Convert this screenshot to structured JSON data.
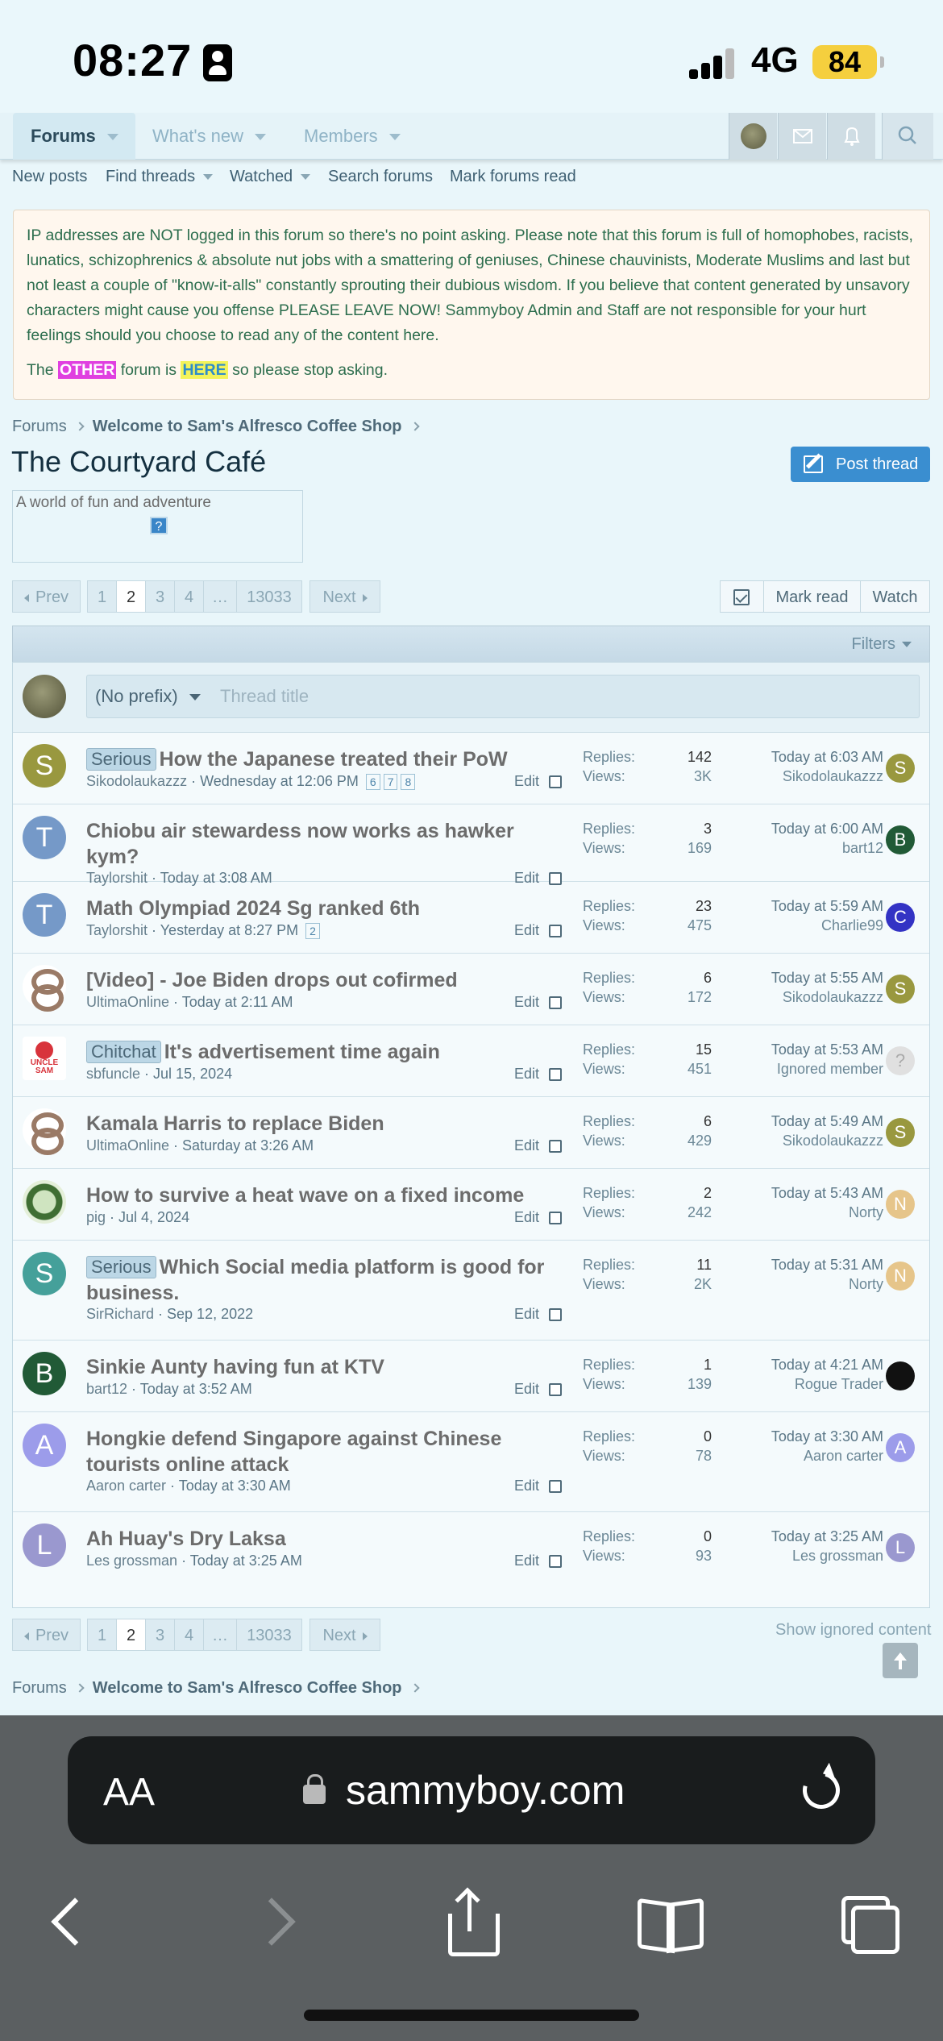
{
  "status": {
    "time": "08:27",
    "network": "4G",
    "battery": "84"
  },
  "nav": {
    "tabs": [
      {
        "label": "Forums"
      },
      {
        "label": "What's new"
      },
      {
        "label": "Members"
      }
    ]
  },
  "subnav": [
    "New posts",
    "Find threads",
    "Watched",
    "Search forums",
    "Mark forums read"
  ],
  "notice": {
    "text": "IP addresses are NOT logged in this forum so there's no point asking. Please note that this forum is full of homophobes, racists, lunatics, schizophrenics & absolute nut jobs with a smattering of geniuses, Chinese chauvinists, Moderate Muslims and last but not least a couple of \"know-it-alls\" constantly sprouting their dubious wisdom. If you believe that content generated by unsavory characters might cause you offense PLEASE LEAVE NOW! Sammyboy Admin and Staff are not responsible for your hurt feelings should you choose to read any of the content here.",
    "line2_a": "The ",
    "other": "OTHER",
    "line2_b": " forum is ",
    "here": "HERE",
    "line2_c": " so please stop asking."
  },
  "breadcrumb": {
    "root": "Forums",
    "parent": "Welcome to Sam's Alfresco Coffee Shop"
  },
  "forum": {
    "title": "The Courtyard Café",
    "post_button": "Post thread",
    "description": "A world of fun and adventure",
    "desc_icon": "?"
  },
  "pagination": {
    "prev": "Prev",
    "pages": [
      "1",
      "2",
      "3",
      "4",
      "…",
      "13033"
    ],
    "current": "2",
    "next": "Next"
  },
  "actions": {
    "mark_read": "Mark read",
    "watch": "Watch"
  },
  "filters": "Filters",
  "quick_thread": {
    "prefix": "(No prefix)",
    "placeholder": "Thread title"
  },
  "labels": {
    "replies": "Replies:",
    "views": "Views:",
    "edit": "Edit"
  },
  "threads": [
    {
      "initial": "S",
      "avatar_color": "#99983f",
      "prefix": "Serious",
      "title": "How the Japanese treated their PoW",
      "author": "Sikodolaukazzz",
      "date": "Wednesday at 12:06 PM",
      "pages": [
        "6",
        "7",
        "8"
      ],
      "replies": "142",
      "views": "3K",
      "last_time": "Today at 6:03 AM",
      "last_user": "Sikodolaukazzz",
      "last_initial": "S",
      "last_color": "#99983f"
    },
    {
      "initial": "T",
      "avatar_color": "#7599c8",
      "prefix": "",
      "title": "Chiobu air stewardess now works as hawker kym?",
      "author": "Taylorshit",
      "date": "Today at 3:08 AM",
      "pages": [],
      "replies": "3",
      "views": "169",
      "last_time": "Today at 6:00 AM",
      "last_user": "bart12",
      "last_initial": "B",
      "last_color": "#215a36"
    },
    {
      "initial": "T",
      "avatar_color": "#7599c8",
      "prefix": "",
      "title": "Math Olympiad 2024 Sg ranked 6th",
      "author": "Taylorshit",
      "date": "Yesterday at 8:27 PM",
      "pages": [
        "2"
      ],
      "replies": "23",
      "views": "475",
      "last_time": "Today at 5:59 AM",
      "last_user": "Charlie99",
      "last_initial": "C",
      "last_color": "#3333c4"
    },
    {
      "initial": "",
      "avatar_color": "knot",
      "prefix": "",
      "title": "[Video] - Joe Biden drops out cofirmed",
      "author": "UltimaOnline",
      "date": "Today at 2:11 AM",
      "pages": [],
      "replies": "6",
      "views": "172",
      "last_time": "Today at 5:55 AM",
      "last_user": "Sikodolaukazzz",
      "last_initial": "S",
      "last_color": "#99983f"
    },
    {
      "initial": "",
      "avatar_color": "uncle",
      "prefix": "Chitchat",
      "title": "It's advertisement time again",
      "author": "sbfuncle",
      "date": "Jul 15, 2024",
      "pages": [],
      "replies": "15",
      "views": "451",
      "last_time": "Today at 5:53 AM",
      "last_user": "Ignored member",
      "last_initial": "?",
      "last_color": "#e0e0e0"
    },
    {
      "initial": "",
      "avatar_color": "knot",
      "prefix": "",
      "title": "Kamala Harris to replace Biden",
      "author": "UltimaOnline",
      "date": "Saturday at 3:26 AM",
      "pages": [],
      "replies": "6",
      "views": "429",
      "last_time": "Today at 5:49 AM",
      "last_user": "Sikodolaukazzz",
      "last_initial": "S",
      "last_color": "#99983f"
    },
    {
      "initial": "",
      "avatar_color": "pig",
      "prefix": "",
      "title": "How to survive a heat wave on a fixed income",
      "author": "pig",
      "date": "Jul 4, 2024",
      "pages": [],
      "replies": "2",
      "views": "242",
      "last_time": "Today at 5:43 AM",
      "last_user": "Norty",
      "last_initial": "N",
      "last_color": "#e6c58a"
    },
    {
      "initial": "S",
      "avatar_color": "#45a09a",
      "prefix": "Serious",
      "title": "Which Social media platform is good for business.",
      "author": "SirRichard",
      "date": "Sep 12, 2022",
      "pages": [],
      "replies": "11",
      "views": "2K",
      "last_time": "Today at 5:31 AM",
      "last_user": "Norty",
      "last_initial": "N",
      "last_color": "#e6c58a"
    },
    {
      "initial": "B",
      "avatar_color": "#215a36",
      "prefix": "",
      "title": "Sinkie Aunty having fun at KTV",
      "author": "bart12",
      "date": "Today at 3:52 AM",
      "pages": [],
      "replies": "1",
      "views": "139",
      "last_time": "Today at 4:21 AM",
      "last_user": "Rogue Trader",
      "last_initial": "",
      "last_color": "#111111"
    },
    {
      "initial": "A",
      "avatar_color": "#9c9cea",
      "prefix": "",
      "title": "Hongkie defend Singapore against Chinese tourists online attack",
      "author": "Aaron carter",
      "date": "Today at 3:30 AM",
      "pages": [],
      "replies": "0",
      "views": "78",
      "last_time": "Today at 3:30 AM",
      "last_user": "Aaron carter",
      "last_initial": "A",
      "last_color": "#9c9cea"
    },
    {
      "initial": "L",
      "avatar_color": "#9a98cf",
      "prefix": "",
      "title": "Ah Huay's Dry Laksa",
      "author": "Les grossman",
      "date": "Today at 3:25 AM",
      "pages": [],
      "replies": "0",
      "views": "93",
      "last_time": "Today at 3:25 AM",
      "last_user": "Les grossman",
      "last_initial": "L",
      "last_color": "#9a98cf"
    }
  ],
  "show_ignored": "Show ignored content",
  "browser": {
    "aa": "AA",
    "domain": "sammyboy.com"
  }
}
